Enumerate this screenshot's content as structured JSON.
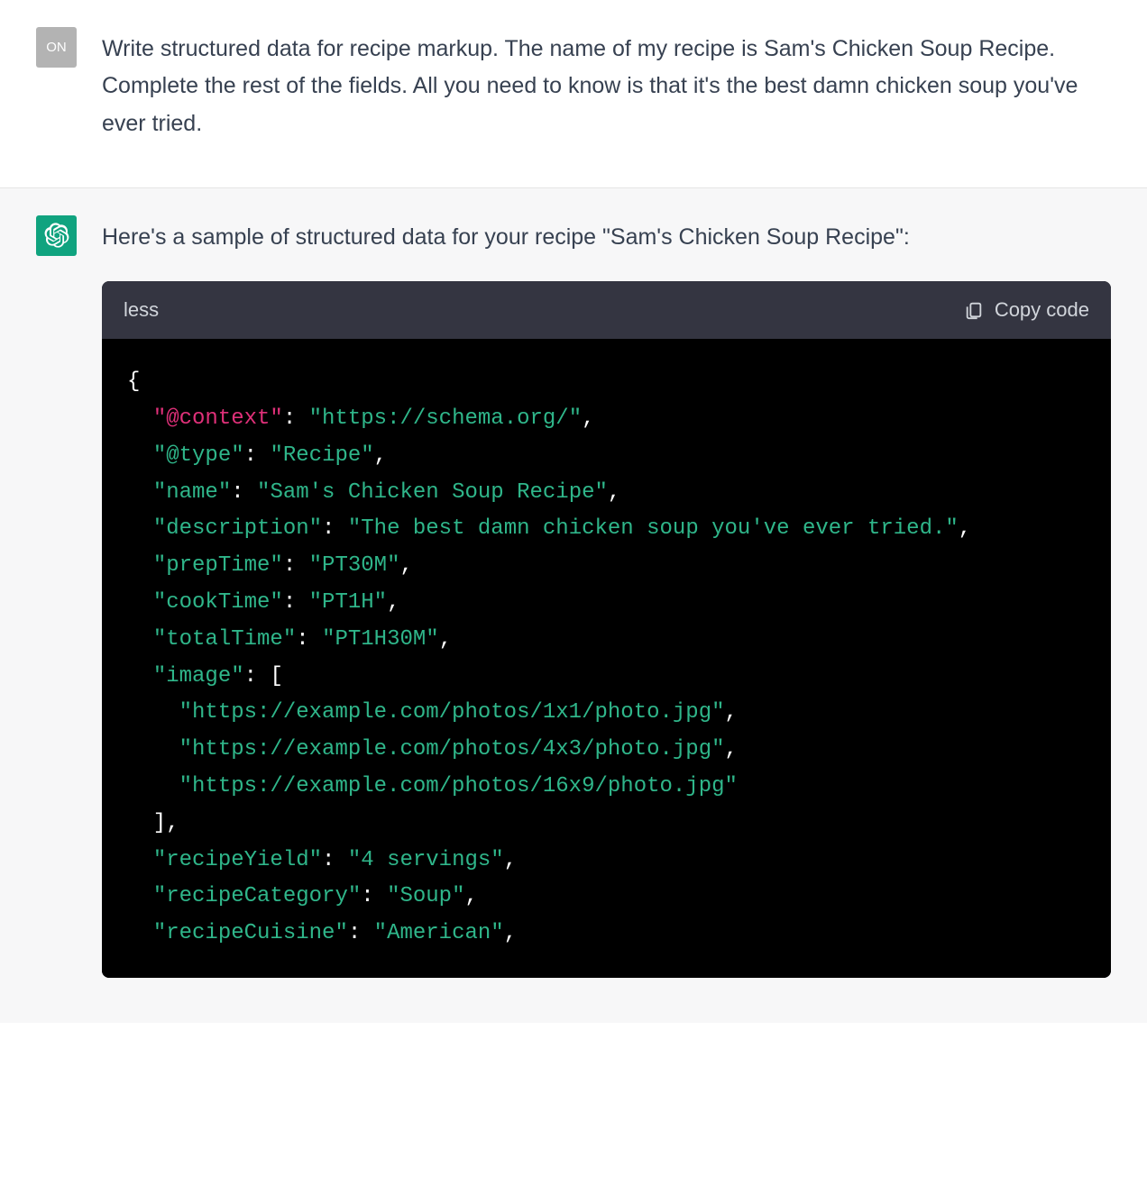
{
  "user": {
    "avatar_label": "ON",
    "message": "Write structured data for recipe markup. The name of my recipe is Sam's Chicken Soup Recipe. Complete the rest of the fields. All you need to know is that it's the best damn chicken soup you've ever tried."
  },
  "assistant": {
    "intro": "Here's a sample of structured data for your recipe \"Sam's Chicken Soup Recipe\":",
    "code": {
      "language": "less",
      "copy_label": "Copy code",
      "lines": [
        [
          {
            "t": "punc",
            "v": "{"
          }
        ],
        [
          {
            "t": "punc",
            "v": "  "
          },
          {
            "t": "attr",
            "v": "\"@context\""
          },
          {
            "t": "punc",
            "v": ": "
          },
          {
            "t": "str",
            "v": "\"https://schema.org/\""
          },
          {
            "t": "punc",
            "v": ","
          }
        ],
        [
          {
            "t": "punc",
            "v": "  "
          },
          {
            "t": "str",
            "v": "\"@type\""
          },
          {
            "t": "punc",
            "v": ": "
          },
          {
            "t": "str",
            "v": "\"Recipe\""
          },
          {
            "t": "punc",
            "v": ","
          }
        ],
        [
          {
            "t": "punc",
            "v": "  "
          },
          {
            "t": "str",
            "v": "\"name\""
          },
          {
            "t": "punc",
            "v": ": "
          },
          {
            "t": "str",
            "v": "\"Sam's Chicken Soup Recipe\""
          },
          {
            "t": "punc",
            "v": ","
          }
        ],
        [
          {
            "t": "punc",
            "v": "  "
          },
          {
            "t": "str",
            "v": "\"description\""
          },
          {
            "t": "punc",
            "v": ": "
          },
          {
            "t": "str",
            "v": "\"The best damn chicken soup you've ever tried.\""
          },
          {
            "t": "punc",
            "v": ","
          }
        ],
        [
          {
            "t": "punc",
            "v": "  "
          },
          {
            "t": "str",
            "v": "\"prepTime\""
          },
          {
            "t": "punc",
            "v": ": "
          },
          {
            "t": "str",
            "v": "\"PT30M\""
          },
          {
            "t": "punc",
            "v": ","
          }
        ],
        [
          {
            "t": "punc",
            "v": "  "
          },
          {
            "t": "str",
            "v": "\"cookTime\""
          },
          {
            "t": "punc",
            "v": ": "
          },
          {
            "t": "str",
            "v": "\"PT1H\""
          },
          {
            "t": "punc",
            "v": ","
          }
        ],
        [
          {
            "t": "punc",
            "v": "  "
          },
          {
            "t": "str",
            "v": "\"totalTime\""
          },
          {
            "t": "punc",
            "v": ": "
          },
          {
            "t": "str",
            "v": "\"PT1H30M\""
          },
          {
            "t": "punc",
            "v": ","
          }
        ],
        [
          {
            "t": "punc",
            "v": "  "
          },
          {
            "t": "str",
            "v": "\"image\""
          },
          {
            "t": "punc",
            "v": ": ["
          }
        ],
        [
          {
            "t": "punc",
            "v": "    "
          },
          {
            "t": "str",
            "v": "\"https://example.com/photos/1x1/photo.jpg\""
          },
          {
            "t": "punc",
            "v": ","
          }
        ],
        [
          {
            "t": "punc",
            "v": "    "
          },
          {
            "t": "str",
            "v": "\"https://example.com/photos/4x3/photo.jpg\""
          },
          {
            "t": "punc",
            "v": ","
          }
        ],
        [
          {
            "t": "punc",
            "v": "    "
          },
          {
            "t": "str",
            "v": "\"https://example.com/photos/16x9/photo.jpg\""
          }
        ],
        [
          {
            "t": "punc",
            "v": "  ],"
          }
        ],
        [
          {
            "t": "punc",
            "v": "  "
          },
          {
            "t": "str",
            "v": "\"recipeYield\""
          },
          {
            "t": "punc",
            "v": ": "
          },
          {
            "t": "str",
            "v": "\"4 servings\""
          },
          {
            "t": "punc",
            "v": ","
          }
        ],
        [
          {
            "t": "punc",
            "v": "  "
          },
          {
            "t": "str",
            "v": "\"recipeCategory\""
          },
          {
            "t": "punc",
            "v": ": "
          },
          {
            "t": "str",
            "v": "\"Soup\""
          },
          {
            "t": "punc",
            "v": ","
          }
        ],
        [
          {
            "t": "punc",
            "v": "  "
          },
          {
            "t": "str",
            "v": "\"recipeCuisine\""
          },
          {
            "t": "punc",
            "v": ": "
          },
          {
            "t": "str",
            "v": "\"American\""
          },
          {
            "t": "punc",
            "v": ","
          }
        ]
      ]
    }
  }
}
